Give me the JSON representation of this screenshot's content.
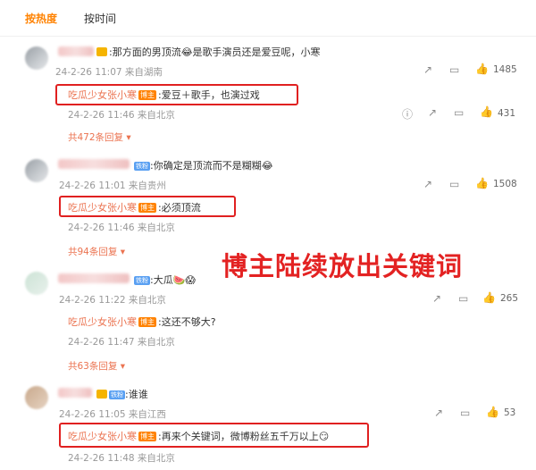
{
  "tabs": {
    "hot": "按热度",
    "time": "按时间"
  },
  "comments": [
    {
      "text": ":那方面的男顶流😂是歌手演员还是爱豆呢，小寒",
      "meta": "24-2-26 11:07 来自湖南",
      "likes": "1485",
      "reply": {
        "author": "吃瓜少女张小寒",
        "badge": "博主",
        "text": ":爱豆＋歌手，也演过戏",
        "meta": "24-2-26 11:46 来自北京",
        "likes": "431"
      },
      "more": "共472条回复"
    },
    {
      "text": ":你确定是顶流而不是糊糊😂",
      "meta": "24-2-26 11:01 来自贵州",
      "likes": "1508",
      "reply": {
        "author": "吃瓜少女张小寒",
        "badge": "博主",
        "text": ":必须顶流",
        "meta": "24-2-26 11:46 来自北京"
      },
      "more": "共94条回复"
    },
    {
      "text": ":大瓜🍉😱",
      "meta": "24-2-26 11:22 来自北京",
      "likes": "265",
      "reply": {
        "author": "吃瓜少女张小寒",
        "badge": "博主",
        "text": ":这还不够大?",
        "meta": "24-2-26 11:47 来自北京"
      },
      "more": "共63条回复"
    },
    {
      "text": ":谁谁",
      "meta": "24-2-26 11:05 来自江西",
      "likes": "53",
      "reply": {
        "author": "吃瓜少女张小寒",
        "badge": "博主",
        "text": ":再来个关键词，微博粉丝五千万以上😏",
        "meta": "24-2-26 11:48 来自北京"
      }
    }
  ],
  "vip_badge": "铁粉",
  "annotation": "博主陆续放出关键词"
}
